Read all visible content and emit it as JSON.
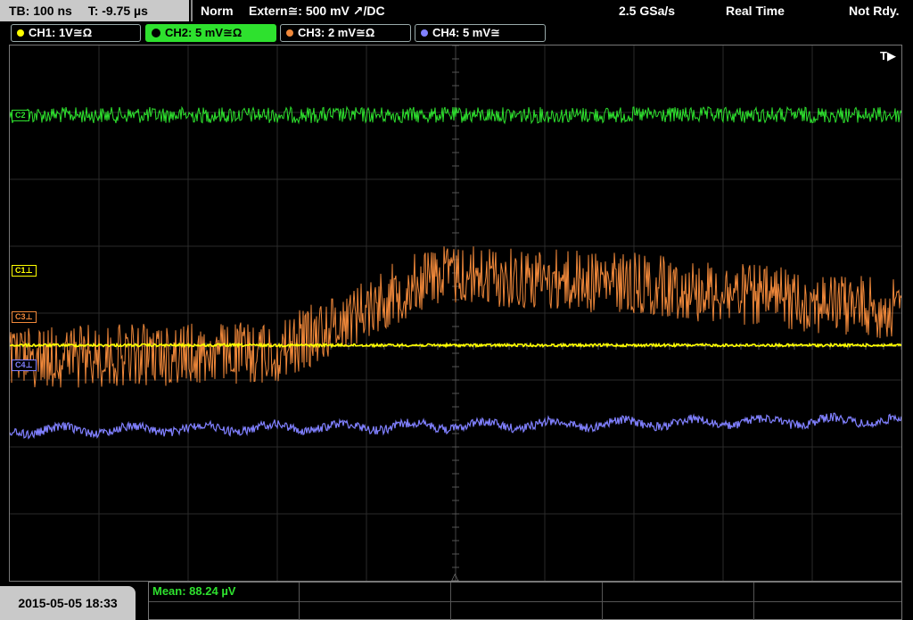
{
  "topbar": {
    "timebase": "TB: 100 ns",
    "trigger_time": "T: -9.75 µs",
    "mode": "Norm",
    "trigger_source": "Extern≅: 500 mV ↗/DC",
    "sample_rate": "2.5 GSa/s",
    "acq_mode": "Real Time",
    "status": "Not Rdy."
  },
  "channels": [
    {
      "label": "CH1: 1V≅Ω",
      "color": "#ffff00"
    },
    {
      "label": "CH2: 5 mV≅Ω",
      "color": "#2ee12e"
    },
    {
      "label": "CH3: 2 mV≅Ω",
      "color": "#f0883a"
    },
    {
      "label": "CH4: 5 mV≅",
      "color": "#8080ff"
    }
  ],
  "markers": {
    "c1": "C1⊥",
    "c2": "C2",
    "c3": "C3⊥",
    "c4": "C4⊥"
  },
  "trigger_indicator": "T▶",
  "bottom": {
    "datetime": "2015-05-05 18:33",
    "measurement": "Mean: 88.24 µV"
  }
}
